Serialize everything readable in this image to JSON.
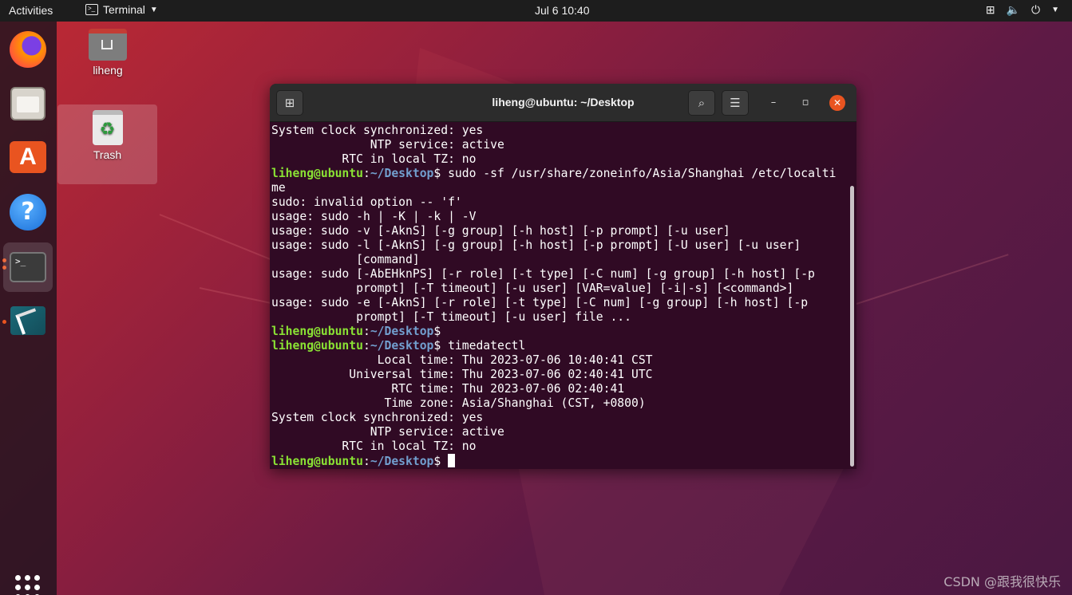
{
  "topbar": {
    "activities": "Activities",
    "app_menu": "Terminal",
    "clock": "Jul 6  10:40"
  },
  "dock": {
    "apps": [
      "firefox-icon",
      "files-icon",
      "app-store-icon",
      "help-icon",
      "terminal-icon",
      "synaptic-icon",
      "show-apps-icon"
    ]
  },
  "desktop": {
    "home_label": "liheng",
    "trash_label": "Trash"
  },
  "window": {
    "title": "liheng@ubuntu: ~/Desktop"
  },
  "prompt": {
    "user_host": "liheng@ubuntu",
    "path": "~/Desktop"
  },
  "terminal_lines": [
    {
      "type": "text",
      "text": "System clock synchronized: yes"
    },
    {
      "type": "text",
      "text": "              NTP service: active"
    },
    {
      "type": "text",
      "text": "          RTC in local TZ: no"
    },
    {
      "type": "prompt",
      "cmd": " sudo -sf /usr/share/zoneinfo/Asia/Shanghai /etc/localti"
    },
    {
      "type": "text",
      "text": "me"
    },
    {
      "type": "text",
      "text": "sudo: invalid option -- 'f'"
    },
    {
      "type": "text",
      "text": "usage: sudo -h | -K | -k | -V"
    },
    {
      "type": "text",
      "text": "usage: sudo -v [-AknS] [-g group] [-h host] [-p prompt] [-u user]"
    },
    {
      "type": "text",
      "text": "usage: sudo -l [-AknS] [-g group] [-h host] [-p prompt] [-U user] [-u user]"
    },
    {
      "type": "text",
      "text": "            [command]"
    },
    {
      "type": "text",
      "text": "usage: sudo [-AbEHknPS] [-r role] [-t type] [-C num] [-g group] [-h host] [-p"
    },
    {
      "type": "text",
      "text": "            prompt] [-T timeout] [-u user] [VAR=value] [-i|-s] [<command>]"
    },
    {
      "type": "text",
      "text": "usage: sudo -e [-AknS] [-r role] [-t type] [-C num] [-g group] [-h host] [-p"
    },
    {
      "type": "text",
      "text": "            prompt] [-T timeout] [-u user] file ..."
    },
    {
      "type": "prompt",
      "cmd": ""
    },
    {
      "type": "prompt",
      "cmd": " timedatectl"
    },
    {
      "type": "text",
      "text": "               Local time: Thu 2023-07-06 10:40:41 CST"
    },
    {
      "type": "text",
      "text": "           Universal time: Thu 2023-07-06 02:40:41 UTC"
    },
    {
      "type": "text",
      "text": "                 RTC time: Thu 2023-07-06 02:40:41"
    },
    {
      "type": "text",
      "text": "                Time zone: Asia/Shanghai (CST, +0800)"
    },
    {
      "type": "text",
      "text": "System clock synchronized: yes"
    },
    {
      "type": "text",
      "text": "              NTP service: active"
    },
    {
      "type": "text",
      "text": "          RTC in local TZ: no"
    },
    {
      "type": "prompt",
      "cmd": " ",
      "cursor": true
    }
  ],
  "watermark": "CSDN @跟我很快乐"
}
